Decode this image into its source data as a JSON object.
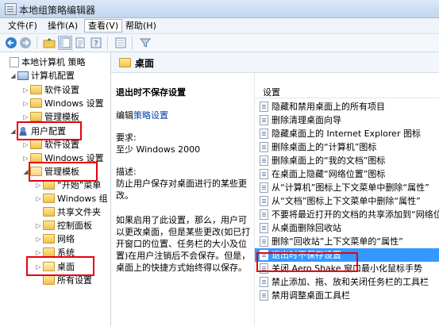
{
  "window": {
    "title": "本地组策略编辑器"
  },
  "menu": [
    "文件(F)",
    "操作(A)",
    "查看(V)",
    "帮助(H)"
  ],
  "tree": {
    "root": "本地计算机 策略",
    "computer_config": "计算机配置",
    "software_settings_1": "软件设置",
    "windows_settings_1": "Windows 设置",
    "admin_templates_1": "管理模板",
    "user_config": "用户配置",
    "software_settings_2": "软件设置",
    "windows_settings_2": "Windows 设置",
    "admin_templates_2": "管理模板",
    "children": [
      "“开始”菜单",
      "Windows 组",
      "共享文件夹",
      "控制面板",
      "网络",
      "系统",
      "桌面",
      "所有设置"
    ]
  },
  "right": {
    "header_title": "桌面",
    "desc_title": "退出时不保存设置",
    "edit_prefix": "编辑",
    "edit_link": "策略设置",
    "req_label": "要求:",
    "req_value": "至少 Windows 2000",
    "desc_label": "描述:",
    "desc_text": "防止用户保存对桌面进行的某些更改。",
    "desc_more": "如果启用了此设置，那么，用户可以更改桌面，但是某些更改(如已打开窗口的位置、任务栏的大小及位置)在用户注销后不会保存。但是，桌面上的快捷方式始终得以保存。"
  },
  "settings": {
    "header": "设置",
    "items": [
      "隐藏和禁用桌面上的所有项目",
      "删除清理桌面向导",
      "隐藏桌面上的 Internet Explorer 图标",
      "删除桌面上的“计算机”图标",
      "删除桌面上的“我的文档”图标",
      "在桌面上隐藏“网络位置”图标",
      "从“计算机”图标上下文菜单中删除“属性”",
      "从“文档”图标上下文菜单中删除“属性”",
      "不要将最近打开的文档的共享添加到“网络位",
      "从桌面删除回收站",
      "删除“回收站”上下文菜单的“属性”",
      "退出时不保存设置",
      "关闭 Aero Shake 窗口最小化鼠标手势",
      "禁止添加、拖、放和关闭任务栏的工具栏",
      "禁用调整桌面工具栏"
    ],
    "selected_index": 11
  },
  "colors": {
    "highlight_box": "#e8000e",
    "selection": "#3399ff"
  }
}
